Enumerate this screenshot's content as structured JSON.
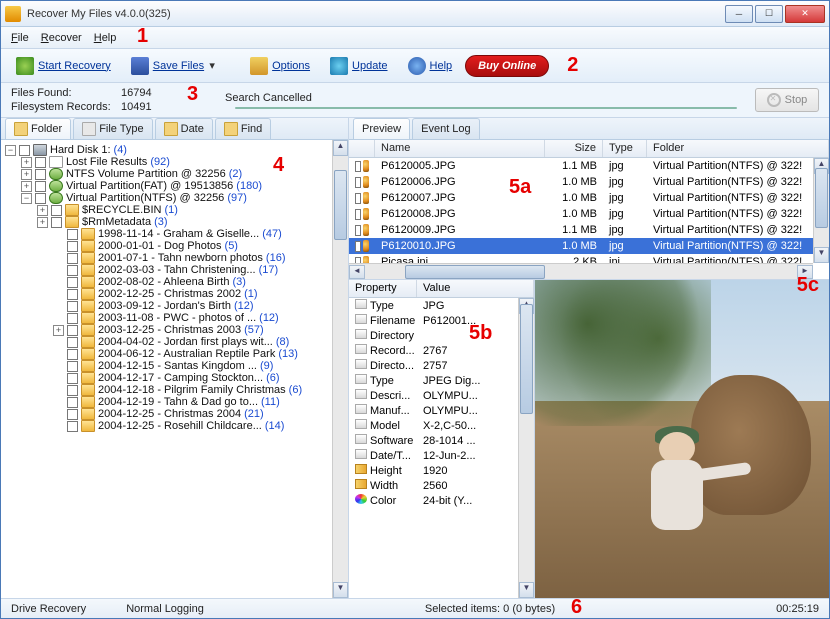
{
  "window": {
    "title": "Recover My Files v4.0.0(325)"
  },
  "menu": {
    "file": "File",
    "recover": "Recover",
    "help": "Help"
  },
  "toolbar": {
    "start": "Start Recovery",
    "save": "Save Files",
    "options": "Options",
    "update": "Update",
    "help": "Help",
    "buy": "Buy Online"
  },
  "stats": {
    "files_label": "Files Found:",
    "files_val": "16794",
    "records_label": "Filesystem Records:",
    "records_val": "10491",
    "search_status": "Search Cancelled",
    "stop": "Stop"
  },
  "left_tabs": {
    "folder": "Folder",
    "filetype": "File Type",
    "date": "Date",
    "find": "Find"
  },
  "tree": {
    "root": "Hard Disk 1:",
    "root_n": "(4)",
    "lost": "Lost File Results",
    "lost_n": "(92)",
    "p1": "NTFS Volume Partition @ 32256",
    "p1_n": "(2)",
    "p2": "Virtual Partition(FAT) @ 19513856",
    "p2_n": "(180)",
    "p3": "Virtual Partition(NTFS) @ 32256",
    "p3_n": "(97)",
    "rbin": "$RECYCLE.BIN",
    "rbin_n": "(1)",
    "rmm": "$RmMetadata",
    "rmm_n": "(3)",
    "f": [
      {
        "label": "1998-11-14 - Graham & Giselle...",
        "n": "(47)"
      },
      {
        "label": "2000-01-01 - Dog Photos",
        "n": "(5)"
      },
      {
        "label": "2001-07-1 - Tahn newborn photos",
        "n": "(16)"
      },
      {
        "label": "2002-03-03 - Tahn Christening...",
        "n": "(17)"
      },
      {
        "label": "2002-08-02 - Ahleena Birth",
        "n": "(3)"
      },
      {
        "label": "2002-12-25 - Christmas 2002",
        "n": "(1)"
      },
      {
        "label": "2003-09-12 - Jordan's Birth",
        "n": "(12)"
      },
      {
        "label": "2003-11-08 - PWC - photos of ...",
        "n": "(12)"
      },
      {
        "label": "2003-12-25 - Christmas 2003",
        "n": "(57)"
      },
      {
        "label": "2004-04-02 - Jordan first plays wit...",
        "n": "(8)"
      },
      {
        "label": "2004-06-12 - Australian Reptile Park",
        "n": "(13)"
      },
      {
        "label": "2004-12-15 - Santas Kingdom ...",
        "n": "(9)"
      },
      {
        "label": "2004-12-17 - Camping Stockton...",
        "n": "(6)"
      },
      {
        "label": "2004-12-18 - Pilgrim Family Christmas",
        "n": "(6)"
      },
      {
        "label": "2004-12-19 - Tahn & Dad go to...",
        "n": "(11)"
      },
      {
        "label": "2004-12-25 - Christmas 2004",
        "n": "(21)"
      },
      {
        "label": "2004-12-25 - Rosehill Childcare...",
        "n": "(14)"
      }
    ]
  },
  "right_tabs": {
    "preview": "Preview",
    "eventlog": "Event Log"
  },
  "filelist": {
    "cols": {
      "name": "Name",
      "size": "Size",
      "type": "Type",
      "folder": "Folder"
    },
    "rows": [
      {
        "name": "P6120005.JPG",
        "size": "1.1 MB",
        "type": "jpg",
        "folder": "Virtual Partition(NTFS) @ 322!"
      },
      {
        "name": "P6120006.JPG",
        "size": "1.0 MB",
        "type": "jpg",
        "folder": "Virtual Partition(NTFS) @ 322!"
      },
      {
        "name": "P6120007.JPG",
        "size": "1.0 MB",
        "type": "jpg",
        "folder": "Virtual Partition(NTFS) @ 322!"
      },
      {
        "name": "P6120008.JPG",
        "size": "1.0 MB",
        "type": "jpg",
        "folder": "Virtual Partition(NTFS) @ 322!"
      },
      {
        "name": "P6120009.JPG",
        "size": "1.1 MB",
        "type": "jpg",
        "folder": "Virtual Partition(NTFS) @ 322!"
      },
      {
        "name": "P6120010.JPG",
        "size": "1.0 MB",
        "type": "jpg",
        "folder": "Virtual Partition(NTFS) @ 322!",
        "selected": true
      },
      {
        "name": "Picasa.ini",
        "size": "2 KB",
        "type": "ini",
        "folder": "Virtual Partition(NTFS) @ 322!"
      }
    ]
  },
  "props": {
    "cols": {
      "p": "Property",
      "v": "Value"
    },
    "rows": [
      {
        "p": "Type",
        "v": "JPG",
        "ico": "tag"
      },
      {
        "p": "Filename",
        "v": "P612001...",
        "ico": "tag"
      },
      {
        "p": "Directory",
        "v": "",
        "ico": "tag"
      },
      {
        "p": "Record...",
        "v": "2767",
        "ico": "tag"
      },
      {
        "p": "Directo...",
        "v": "2757",
        "ico": "tag"
      },
      {
        "p": "Type",
        "v": "JPEG Dig...",
        "ico": "tag"
      },
      {
        "p": "Descri...",
        "v": "OLYMPU...",
        "ico": "tag"
      },
      {
        "p": "Manuf...",
        "v": "OLYMPU...",
        "ico": "tag"
      },
      {
        "p": "Model",
        "v": "X-2,C-50...",
        "ico": "tag"
      },
      {
        "p": "Software",
        "v": "28-1014 ...",
        "ico": "tag"
      },
      {
        "p": "Date/T...",
        "v": "12-Jun-2...",
        "ico": "tag"
      },
      {
        "p": "Height",
        "v": "1920",
        "ico": "ruler"
      },
      {
        "p": "Width",
        "v": "2560",
        "ico": "ruler"
      },
      {
        "p": "Color",
        "v": "24-bit (Y...",
        "ico": "pal"
      }
    ]
  },
  "statusbar": {
    "left": "Drive Recovery",
    "logging": "Normal Logging",
    "selected": "Selected items: 0 (0 bytes)",
    "time": "00:25:19"
  },
  "callouts": {
    "c1": "1",
    "c2": "2",
    "c3": "3",
    "c4": "4",
    "c5a": "5a",
    "c5b": "5b",
    "c5c": "5c",
    "c6": "6"
  }
}
